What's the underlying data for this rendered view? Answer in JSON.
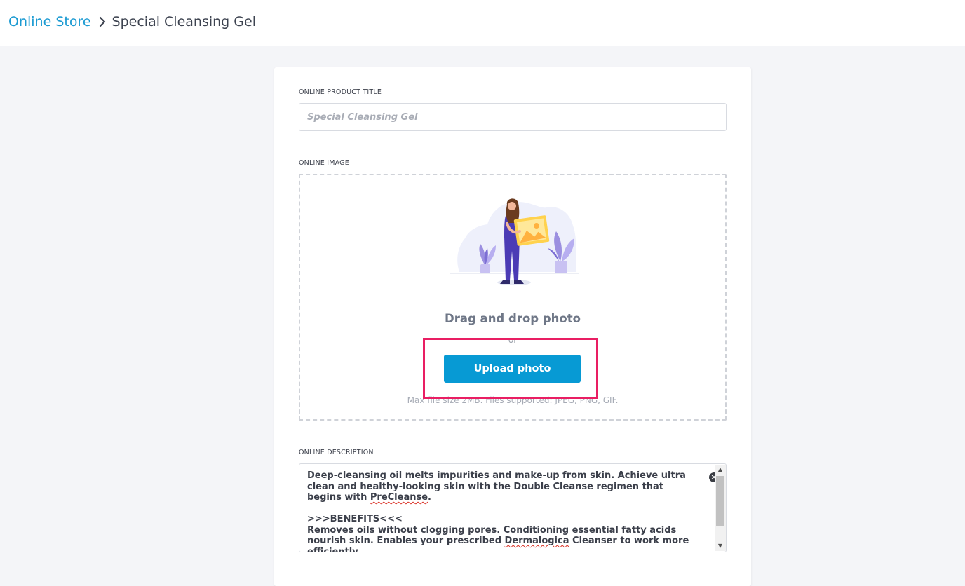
{
  "breadcrumb": {
    "root": "Online Store",
    "current": "Special Cleansing Gel"
  },
  "form": {
    "title_label": "ONLINE PRODUCT TITLE",
    "title_placeholder": "Special Cleansing Gel",
    "title_value": "",
    "image_label": "ONLINE IMAGE",
    "dropzone": {
      "heading": "Drag and drop photo",
      "or_text": "or",
      "upload_label": "Upload photo",
      "hint": "Max file size 2MB. Files supported: JPEG, PNG, GIF."
    },
    "description_label": "ONLINE DESCRIPTION",
    "description": {
      "p1_a": "Deep-cleansing oil melts impurities and make-up from skin. Achieve ultra clean and healthy-looking skin with the Double Cleanse regimen that begins with ",
      "p1_word": "PreCleanse",
      "p1_b": ".",
      "p2_heading": ">>>BENEFITS<<<",
      "p2_a": "Removes oils without clogging pores. Conditioning essential fatty acids nourish skin. Enables your prescribed ",
      "p2_word": "Dermalogica",
      "p2_b": " Cleanser to work more efficiently."
    }
  },
  "colors": {
    "accent": "#079ad4",
    "link": "#1a9ad2",
    "highlight": "#e91e63",
    "background": "#f4f5f8"
  },
  "icons": {
    "breadcrumb_separator": "chevron-right-icon",
    "clear": "clear-icon",
    "illustration": "upload-photo-illustration"
  }
}
